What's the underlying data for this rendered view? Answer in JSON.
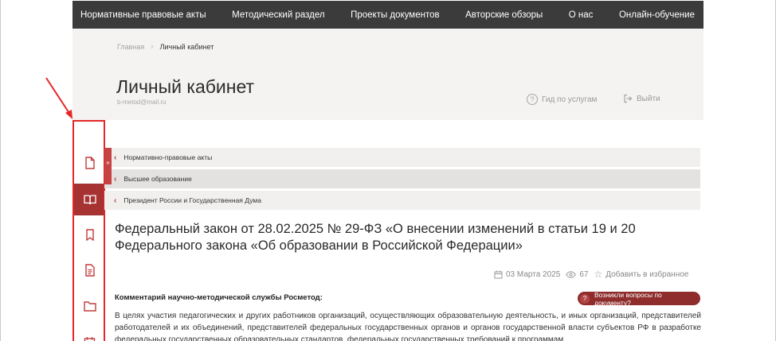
{
  "topnav": {
    "items": [
      "Нормативные правовые акты",
      "Методический раздел",
      "Проекты документов",
      "Авторские обзоры",
      "О нас",
      "Онлайн-обучение"
    ]
  },
  "breadcrumb": {
    "home": "Главная",
    "current": "Личный кабинет"
  },
  "header": {
    "title": "Личный кабинет",
    "email": "b-metod@mail.ru",
    "guide": "Гид по услугам",
    "logout": "Выйти"
  },
  "sidebar": {
    "icons": [
      "document-icon",
      "open-book-icon",
      "bookmark-icon",
      "text-document-icon",
      "folder-icon",
      "calendar-icon"
    ],
    "active_index": 1,
    "active_color": "#a63232"
  },
  "annotation_color": "#e52727",
  "accordion": {
    "toggle": "»",
    "items": [
      "Нормативно-правовые акты",
      "Высшее образование",
      "Президент России и Государственная Дума"
    ]
  },
  "article": {
    "title": "Федеральный закон от 28.02.2025 № 29-ФЗ «О внесении изменений в статьи 19 и 20 Федерального закона «Об образовании в Российской Федерации»",
    "date": "03 Марта 2025",
    "views": "67",
    "favorite": "Добавить в избранное",
    "comment_label": "Комментарий научно-методической службы Росметод:",
    "ask_button": "Возникли вопросы по документу?",
    "body": "В целях участия педагогических и других работников организаций, осуществляющих образовательную деятельность, и иных организаций, представителей работодателей и их объединений, представителей федеральных государственных органов и органов государственной власти субъектов РФ в разработке федеральных государственных образовательных стандартов, федеральных государственных требований к программам"
  }
}
